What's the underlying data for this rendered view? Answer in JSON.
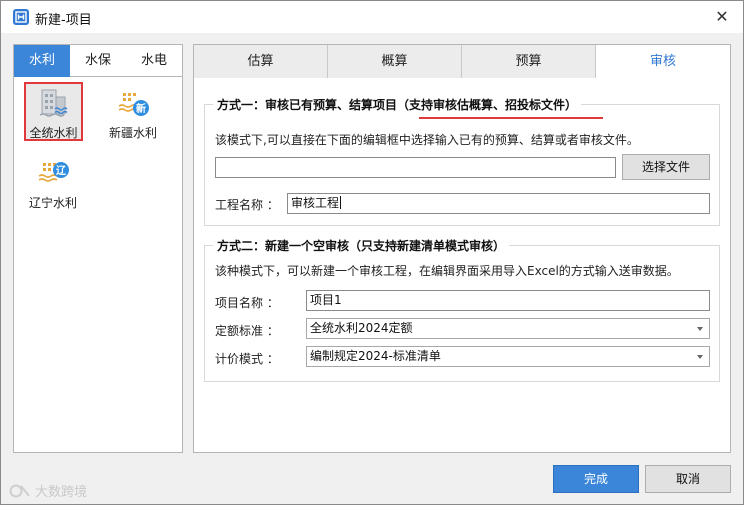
{
  "window": {
    "title": "新建-项目",
    "close_glyph": "✕"
  },
  "left_tabs": [
    "水利",
    "水保",
    "水电"
  ],
  "provinces": [
    {
      "label": "全统水利",
      "icon": "building-icon",
      "badge": ""
    },
    {
      "label": "新疆水利",
      "icon": "water-building-icon",
      "badge": "新"
    },
    {
      "label": "辽宁水利",
      "icon": "water-building-icon",
      "badge": "辽"
    }
  ],
  "right_tabs": [
    "估算",
    "概算",
    "预算",
    "审核"
  ],
  "method1": {
    "title_prefix": "方式一：审核已有预算、结算项目",
    "title_highlight": "（支持审核估概算、招投标文件）",
    "description": "该模式下,可以直接在下面的编辑框中选择输入已有的预算、结算或者审核文件。",
    "file_path": "",
    "choose_file_button": "选择文件",
    "project_name_label": "工程名称 ：",
    "project_name_value": "审核工程"
  },
  "method2": {
    "title": "方式二：新建一个空审核（只支持新建清单模式审核）",
    "description": "该种模式下，可以新建一个审核工程，在编辑界面采用导入Excel的方式输入送审数据。",
    "fields": [
      {
        "label": "项目名称 ：",
        "value": "项目1",
        "type": "text"
      },
      {
        "label": "定额标准 ：",
        "value": "全统水利2024定额",
        "type": "select"
      },
      {
        "label": "计价模式 ：",
        "value": "编制规定2024-标准清单",
        "type": "select"
      }
    ]
  },
  "footer": {
    "finish_button": "完成",
    "cancel_button": "取消"
  },
  "watermark": "大数跨境",
  "colors": {
    "accent": "#3b86d9",
    "highlight_red": "#e0383b"
  }
}
